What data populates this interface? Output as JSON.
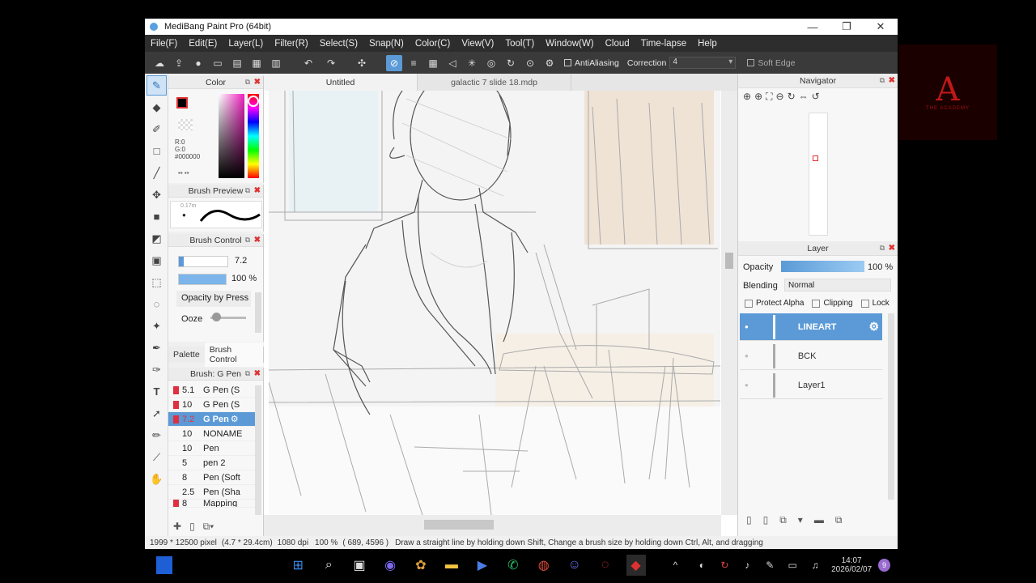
{
  "window": {
    "title": "MediBang Paint Pro (64bit)",
    "controls": [
      "—",
      "❐",
      "✕"
    ]
  },
  "menu": [
    "File(F)",
    "Edit(E)",
    "Layer(L)",
    "Filter(R)",
    "Select(S)",
    "Snap(N)",
    "Color(C)",
    "View(V)",
    "Tool(T)",
    "Window(W)",
    "Cloud",
    "Time-lapse",
    "Help"
  ],
  "toolbar": {
    "antialiasing_label": "AntiAliasing",
    "correction_label": "Correction",
    "correction_value": "4",
    "soft_edge_label": "Soft Edge"
  },
  "color_panel": {
    "title": "Color",
    "r": "R:0",
    "g": "G:0",
    "b": "B:0",
    "hex": "#000000",
    "primary_color": "#000000",
    "secondary_color": "#ffffff"
  },
  "brush_preview": {
    "title": "Brush Preview",
    "size_label": "0.17m"
  },
  "brush_control": {
    "title": "Brush Control",
    "size_value": "7.2",
    "opacity_value": "100 %",
    "opacity_by_pressure": "Opacity by Press",
    "ooze_label": "Ooze"
  },
  "panel_tabs": [
    "Palette",
    "Brush Control"
  ],
  "brush_list": {
    "title": "Brush: G Pen",
    "items": [
      {
        "size": "5.1",
        "name": "G Pen (S",
        "swatch": true
      },
      {
        "size": "10",
        "name": "G Pen (S",
        "swatch": true
      },
      {
        "size": "7.2",
        "name": "G Pen",
        "swatch": true,
        "selected": true
      },
      {
        "size": "10",
        "name": "NONAME",
        "swatch": false
      },
      {
        "size": "10",
        "name": "Pen",
        "swatch": false
      },
      {
        "size": "5",
        "name": "pen 2",
        "swatch": false
      },
      {
        "size": "8",
        "name": "Pen (Soft",
        "swatch": false
      },
      {
        "size": "2.5",
        "name": "Pen (Sha",
        "swatch": false
      },
      {
        "size": "8",
        "name": "Mapping",
        "swatch": true
      }
    ]
  },
  "tabs": [
    "Untitled",
    "galactic 7 slide 18.mdp"
  ],
  "navigator": {
    "title": "Navigator"
  },
  "layer_panel": {
    "title": "Layer",
    "opacity_label": "Opacity",
    "opacity_value": "100 %",
    "opacity_fraction": 1.0,
    "blending_label": "Blending",
    "blending_value": "Normal",
    "protect_alpha": "Protect Alpha",
    "clipping": "Clipping",
    "lock": "Lock",
    "layers": [
      {
        "name": "LINEART",
        "selected": true
      },
      {
        "name": "BCK",
        "selected": false
      },
      {
        "name": "Layer1",
        "selected": false
      }
    ]
  },
  "status": {
    "dimensions": "1999 * 12500 pixel",
    "physical": "(4.7 * 29.4cm)",
    "dpi": "1080 dpi",
    "zoom": "100 %",
    "coords": "( 689, 4596 )",
    "hint": "Draw a straight line by holding down Shift, Change a brush size by holding down Ctrl, Alt, and dragging"
  },
  "taskbar": {
    "time": "14:07",
    "date": "2026/02/07",
    "notification_count": "9"
  },
  "logo": {
    "text": "THE ACADEMY"
  }
}
